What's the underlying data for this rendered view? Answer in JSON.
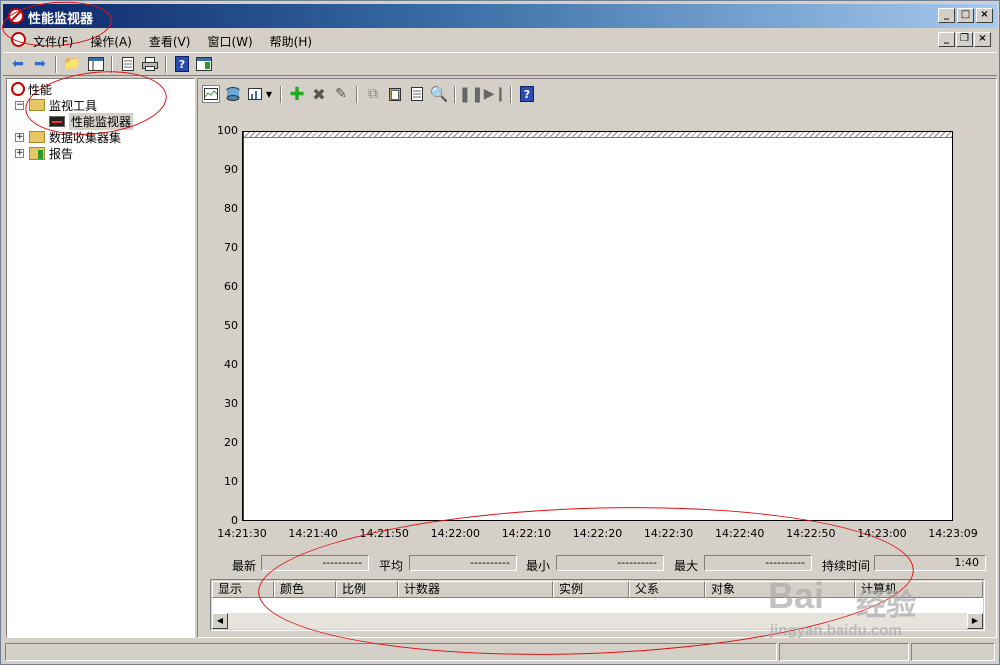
{
  "window": {
    "title": "性能监视器",
    "caption_buttons": {
      "minimize": "_",
      "maximize": "□",
      "close": "×"
    },
    "mdi_buttons": {
      "minimize": "_",
      "restore": "❐",
      "close": "×"
    }
  },
  "menubar": {
    "items": [
      "文件(F)",
      "操作(A)",
      "查看(V)",
      "窗口(W)",
      "帮助(H)"
    ]
  },
  "toolbar": {
    "icons": [
      "back-arrow-icon",
      "forward-arrow-icon",
      "up-folder-icon",
      "show-hide-tree-icon",
      "export-list-icon",
      "print-icon",
      "help-icon",
      "show-action-pane-icon"
    ]
  },
  "tree": {
    "root": "性能",
    "monitoring_tools": "监视工具",
    "performance_monitor": "性能监视器",
    "data_collector_sets": "数据收集器集",
    "reports": "报告"
  },
  "graph": {
    "y_ticks": [
      "100",
      "90",
      "80",
      "70",
      "60",
      "50",
      "40",
      "30",
      "20",
      "10",
      "0"
    ],
    "x_ticks": [
      "14:21:30",
      "14:21:40",
      "14:21:50",
      "14:22:00",
      "14:22:10",
      "14:22:20",
      "14:22:30",
      "14:22:40",
      "14:22:50",
      "14:23:00",
      "14:23:09"
    ],
    "line_color": "#e00000"
  },
  "stats": {
    "last_label": "最新",
    "last_value": "----------",
    "avg_label": "平均",
    "avg_value": "----------",
    "min_label": "最小",
    "min_value": "----------",
    "max_label": "最大",
    "max_value": "----------",
    "duration_label": "持续时间",
    "duration_value": "1:40"
  },
  "legend": {
    "columns": [
      "显示",
      "颜色",
      "比例",
      "计数器",
      "实例",
      "父系",
      "对象",
      "计算机"
    ]
  },
  "watermark": {
    "brand": "Bai",
    "brand2": "经验",
    "url": "jingyan.baidu.com"
  }
}
